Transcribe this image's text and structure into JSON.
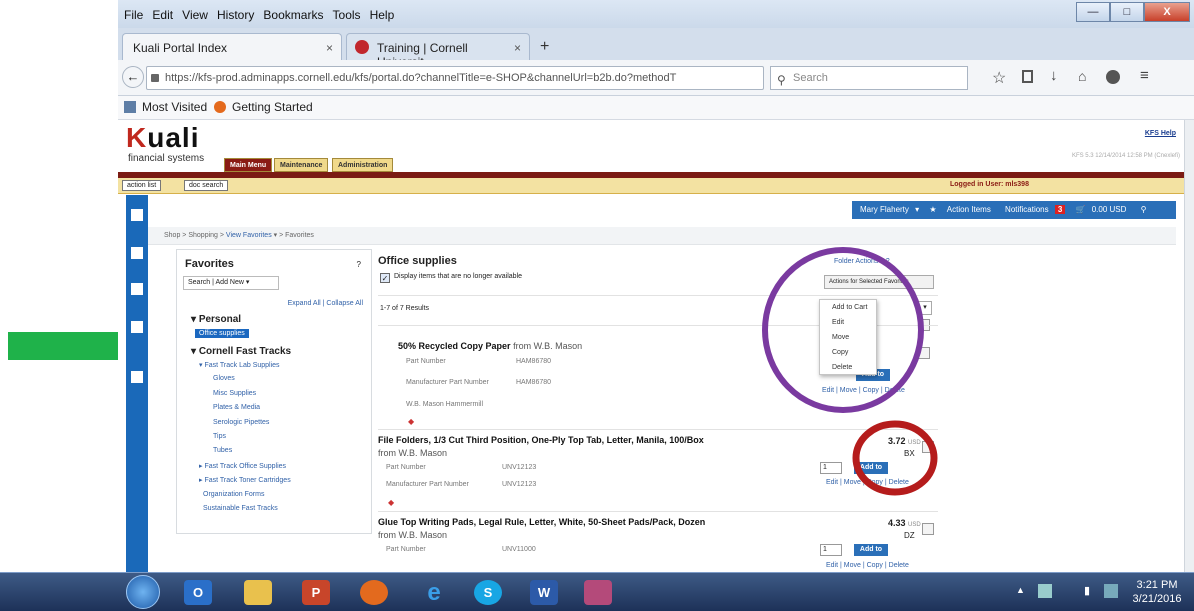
{
  "browser": {
    "menu": [
      "File",
      "Edit",
      "View",
      "History",
      "Bookmarks",
      "Tools",
      "Help"
    ],
    "tabs": [
      {
        "label": "Kuali Portal Index",
        "active": true
      },
      {
        "label": "Training | Cornell Universit...",
        "active": false
      }
    ],
    "new_tab": "+",
    "url": "https://kfs-prod.adminapps.cornell.edu/kfs/portal.do?channelTitle=e-SHOP&channelUrl=b2b.do?methodT",
    "search_placeholder": "Search",
    "bookmarks": [
      "Most Visited",
      "Getting Started"
    ]
  },
  "kuali": {
    "logo_mark": "K",
    "logo_rest": "uali",
    "logo_sub": "financial systems",
    "help": "KFS Help",
    "tabs": [
      "Main Menu",
      "Maintenance",
      "Administration"
    ],
    "version": "KFS 5.3 12/14/2014 12:58 PM (Cnexlefi)",
    "action_list": "action list",
    "doc_search": "doc search",
    "logged_in": "Logged in User: mls398"
  },
  "shop_nav": {
    "user": "Mary Flaherty",
    "action_items": "Action Items",
    "notifications": "Notifications",
    "notif_count": "3",
    "cart_total": "0.00 USD",
    "breadcrumb": [
      "Shop",
      "Shopping",
      "View Favorites",
      "Favorites"
    ]
  },
  "favorites": {
    "title": "Favorites",
    "help": "?",
    "search": "Search",
    "add_new": "Add New",
    "expand_all": "Expand All",
    "collapse_all": "Collapse All",
    "personal": "Personal",
    "office_supplies": "Office supplies",
    "cornell_fast_tracks": "Cornell Fast Tracks",
    "fast_track_lab": "Fast Track Lab Supplies",
    "lab_items": [
      "Gloves",
      "Misc Supplies",
      "Plates & Media",
      "Serologic Pipettes",
      "Tips",
      "Tubes"
    ],
    "more_items": [
      "Fast Track Office Supplies",
      "Fast Track Toner Cartridges",
      "Organization Forms",
      "Sustainable Fast Tracks"
    ]
  },
  "folder": {
    "title": "Office supplies",
    "folder_actions": "Folder Actions",
    "help": "?",
    "display_unavailable": "Display items that are no longer available",
    "actions_selected": "Actions for Selected Favorites",
    "results": "1-7 of 7 Results",
    "menu_items": [
      "Add to Cart",
      "Edit",
      "Move",
      "Copy",
      "Delete"
    ]
  },
  "products": [
    {
      "name": "50% Recycled Copy Paper",
      "supplier": "from W.B. Mason",
      "part_label": "Part Number",
      "part": "HAM86780",
      "mfr_label": "Manufacturer Part Number",
      "mfr": "HAM86780",
      "brand": "W.B. Mason Hammermill",
      "qty": "1",
      "add": "Add to Cart",
      "links": "Edit | Move | Copy | Delete"
    },
    {
      "name": "File Folders, 1/3 Cut Third Position, One-Ply Top Tab, Letter, Manila, 100/Box",
      "supplier": "from W.B. Mason",
      "price": "3.72",
      "currency": "USD",
      "unit": "BX",
      "part_label": "Part Number",
      "part": "UNV12123",
      "mfr_label": "Manufacturer Part Number",
      "mfr": "UNV12123",
      "qty": "1",
      "add": "Add to Cart",
      "links": "Edit | Move | Copy | Delete"
    },
    {
      "name": "Glue Top Writing Pads, Legal Rule, Letter, White, 50-Sheet Pads/Pack, Dozen",
      "supplier": "from W.B. Mason",
      "price": "4.33",
      "currency": "USD",
      "unit": "DZ",
      "part_label": "Part Number",
      "part": "UNV11000",
      "qty": "1",
      "add": "Add to Cart",
      "links": "Edit | Move | Copy | Delete"
    }
  ],
  "taskbar": {
    "time": "3:21 PM",
    "date": "3/21/2016"
  },
  "colors": {
    "arrow": "#1fb24a",
    "purple_ring": "#7a3aa0",
    "red_ring": "#b51c1c",
    "kuali_red": "#bf2a1f",
    "rail_blue": "#1a69b9"
  }
}
